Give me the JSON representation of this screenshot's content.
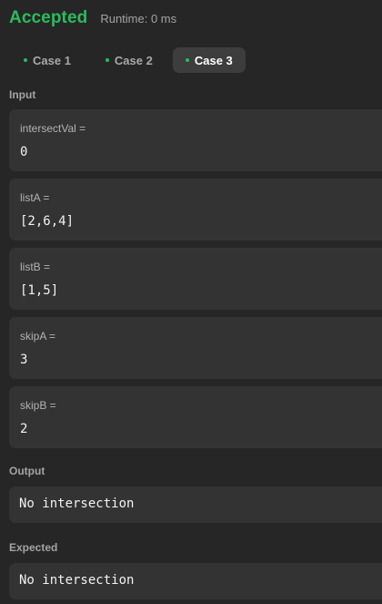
{
  "result": {
    "status": "Accepted",
    "runtime": "Runtime: 0 ms",
    "status_color": "#2cbb5d"
  },
  "cases": [
    {
      "label": "Case 1",
      "active": false
    },
    {
      "label": "Case 2",
      "active": false
    },
    {
      "label": "Case 3",
      "active": true
    }
  ],
  "input": {
    "label": "Input",
    "params": [
      {
        "name": "intersectVal =",
        "value": "0"
      },
      {
        "name": "listA =",
        "value": "[2,6,4]"
      },
      {
        "name": "listB =",
        "value": "[1,5]"
      },
      {
        "name": "skipA =",
        "value": "3"
      },
      {
        "name": "skipB =",
        "value": "2"
      }
    ]
  },
  "output": {
    "label": "Output",
    "value": "No intersection"
  },
  "expected": {
    "label": "Expected",
    "value": "No intersection"
  }
}
